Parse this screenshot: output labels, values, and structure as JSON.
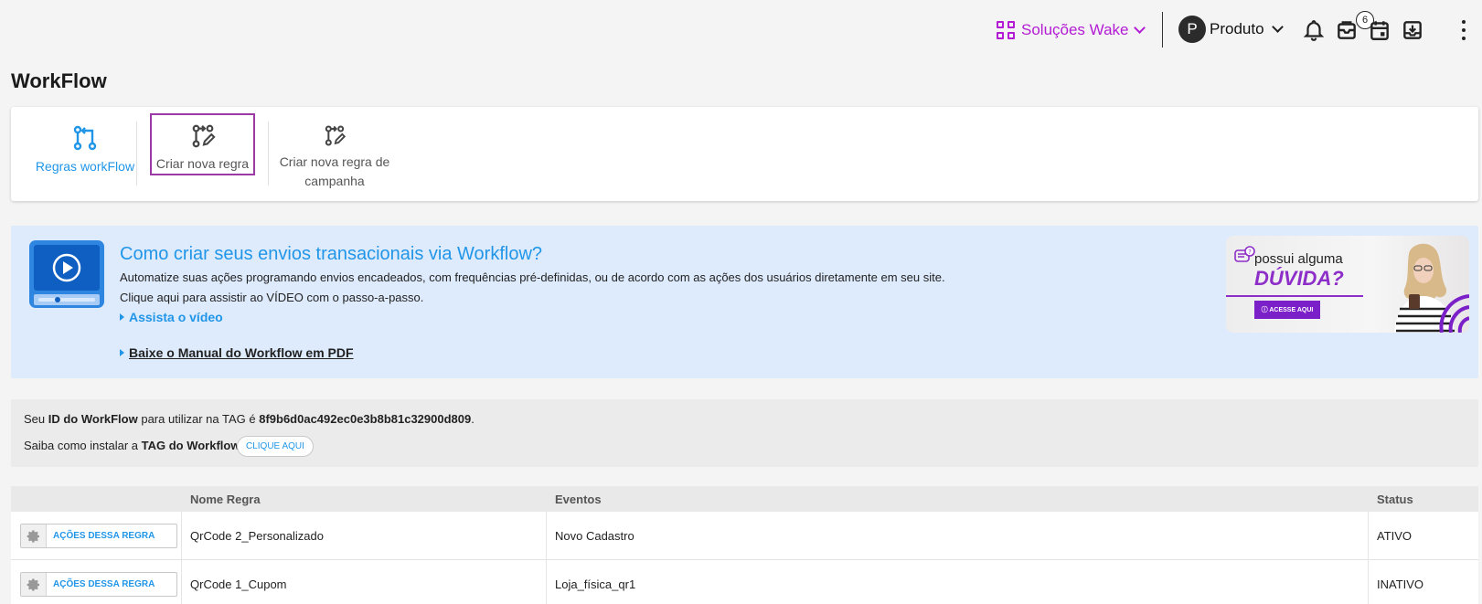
{
  "topbar": {
    "solucoes_label": "Soluções Wake",
    "avatar_initial": "P",
    "produto_label": "Produto",
    "notifications_badge": "6"
  },
  "page_title": "WorkFlow",
  "tabs": [
    {
      "label": "Regras workFlow"
    },
    {
      "label": "Criar nova regra"
    },
    {
      "label": "Criar nova regra de campanha"
    }
  ],
  "banner": {
    "title": "Como criar seus envios transacionais via Workflow?",
    "text1": "Automatize suas ações programando envios encadeados, com frequências pré-definidas, ou de acordo com as ações dos usuários diretamente em seu site.",
    "text2": "Clique aqui para assistir ao VÍDEO com o passo-a-passo.",
    "link_video": "Assista o vídeo",
    "link_manual": "Baixe o Manual do Workflow em PDF",
    "promo": {
      "line1": "possui alguma",
      "line2": "DÚVIDA?",
      "button": "ⓘ ACESSE AQUI"
    }
  },
  "id_box": {
    "prefix": "Seu ",
    "id_label": "ID do WorkFlow",
    "middle": " para utilizar na TAG é ",
    "id_value": "8f9b6d0ac492ec0e3b8b81c32900d809",
    "suffix": ".",
    "install_prefix": "Saiba como instalar a ",
    "install_bold": "TAG do Workflow",
    "button": "CLIQUE AQUI"
  },
  "table": {
    "headers": [
      "Nome Regra",
      "Eventos",
      "Status"
    ],
    "action_label": "AÇÕES DESSA REGRA",
    "rows": [
      {
        "name": "QrCode 2_Personalizado",
        "event": "Novo Cadastro",
        "status": "ATIVO"
      },
      {
        "name": "QrCode 1_Cupom",
        "event": "Loja_física_qr1",
        "status": "INATIVO"
      }
    ]
  },
  "colors": {
    "accent_blue": "#2196e8",
    "brand_purple": "#b31cd4",
    "selected_border": "#9c3aa5",
    "banner_bg": "#deebfc"
  }
}
